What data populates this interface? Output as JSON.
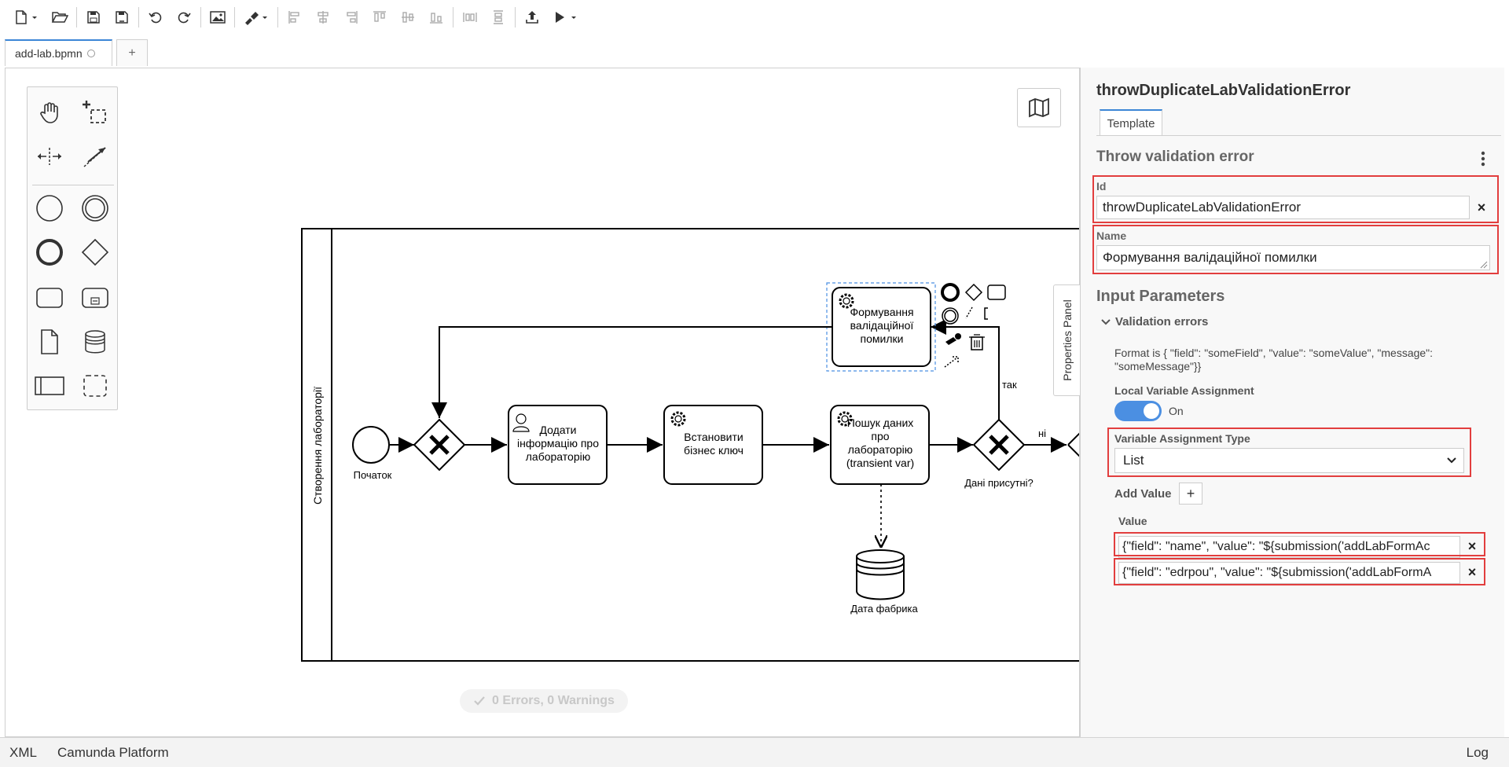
{
  "toolbar": {
    "icons": [
      "new-file-icon",
      "open-file-icon",
      "save-icon",
      "save-as-icon",
      "undo-icon",
      "redo-icon",
      "export-image-icon",
      "color-picker-icon",
      "align-left-icon",
      "align-center-icon",
      "align-right-icon",
      "align-top-icon",
      "align-middle-icon",
      "align-bottom-icon",
      "distribute-horizontal-icon",
      "distribute-vertical-icon",
      "deploy-icon",
      "run-icon"
    ]
  },
  "tabs": {
    "active_label": "add-lab.bpmn",
    "add_label": "+"
  },
  "diagram": {
    "lane_label": "Створення лабораторії",
    "start_label": "Початок",
    "task_add_info": [
      "Додати",
      "інформацію про",
      "лабораторію"
    ],
    "task_business_key": [
      "Встановити",
      "бізнес ключ"
    ],
    "task_search": [
      "Пошук даних",
      "про",
      "лабораторію",
      "(transient var)"
    ],
    "task_error": [
      "Формування",
      "валідаційної",
      "помилки"
    ],
    "gateway_label": "Дані присутні?",
    "flow_yes": "так",
    "flow_no": "ні",
    "datastore_label": "Дата фабрика"
  },
  "status": {
    "text": "0 Errors, 0 Warnings"
  },
  "properties_toggle": "Properties Panel",
  "panel": {
    "title": "throwDuplicateLabValidationError",
    "tab_label": "Template",
    "group_title": "Throw validation error",
    "id_label": "Id",
    "id_value": "throwDuplicateLabValidationError",
    "name_label": "Name",
    "name_value": "Формування валідаційної помилки",
    "input_parameters_title": "Input Parameters",
    "validation_errors_label": "Validation errors",
    "format_text": "Format is { \"field\": \"someField\", \"value\": \"someValue\", \"message\": \"someMessage\"}}",
    "local_var_label": "Local Variable Assignment",
    "toggle_state": "On",
    "var_type_label": "Variable Assignment Type",
    "var_type_value": "List",
    "add_value_label": "Add Value",
    "add_button": "+",
    "value_label": "Value",
    "values": [
      "{\"field\": \"name\", \"value\": \"${submission('addLabFormAc",
      "{\"field\": \"edrpou\", \"value\": \"${submission('addLabFormA"
    ]
  },
  "bottombar": {
    "xml": "XML",
    "platform": "Camunda Platform",
    "log": "Log"
  }
}
